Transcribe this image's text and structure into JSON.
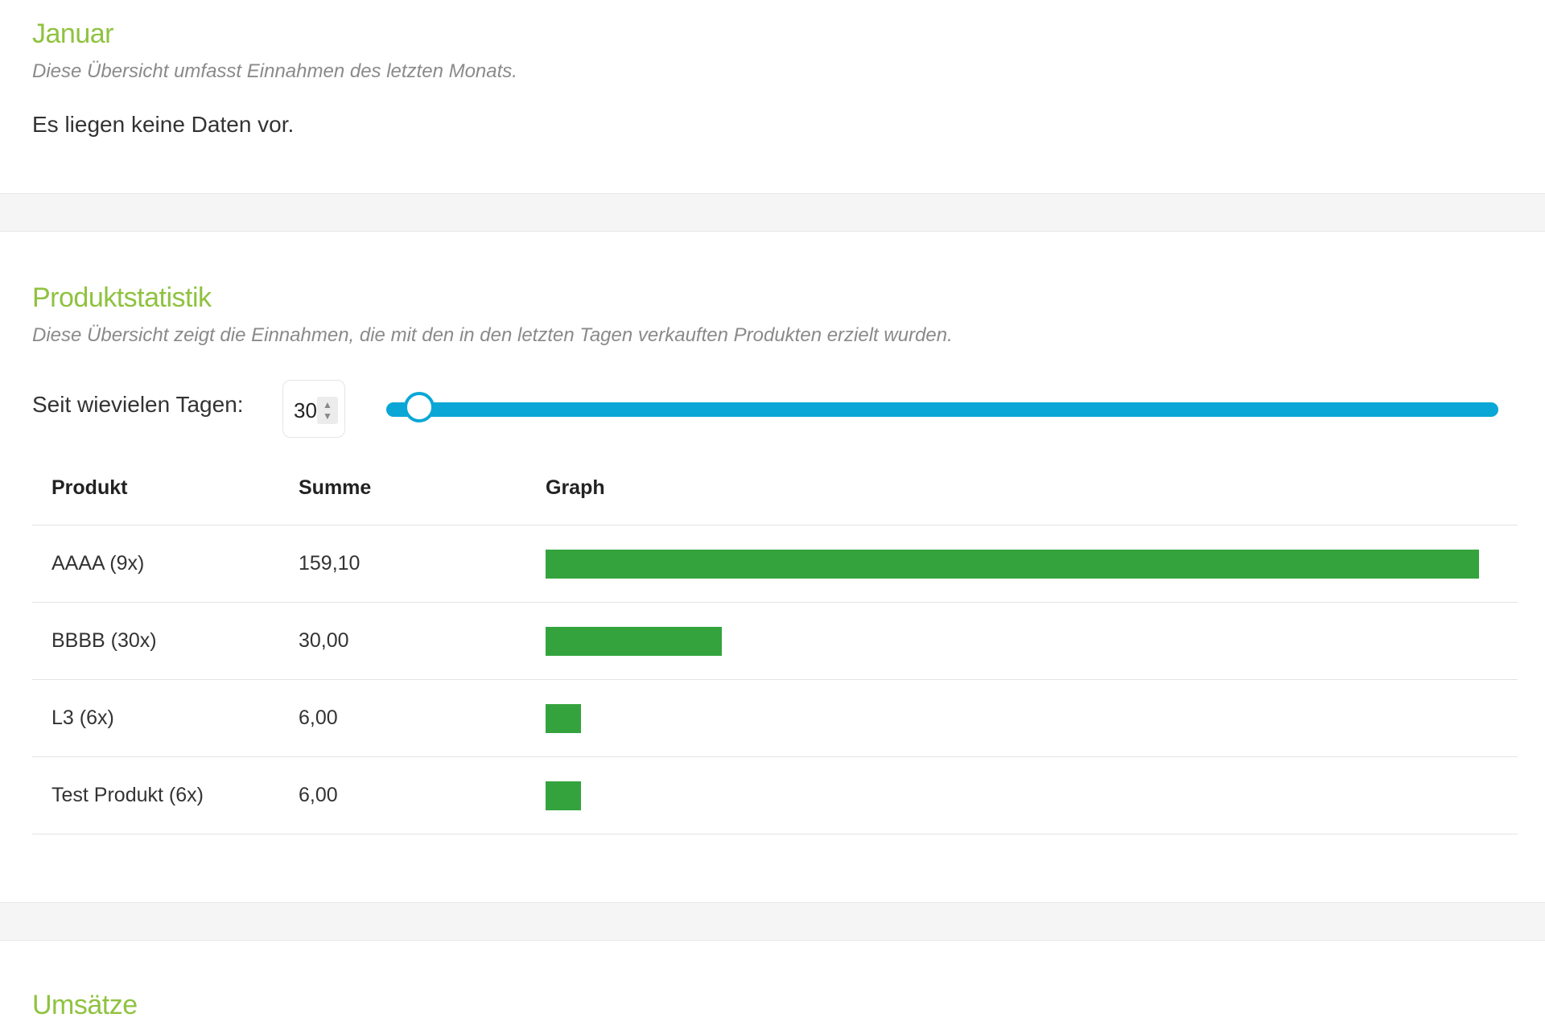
{
  "januar": {
    "title": "Januar",
    "subtitle": "Diese Übersicht umfasst Einnahmen des letzten Monats.",
    "empty_text": "Es liegen keine Daten vor."
  },
  "produktstatistik": {
    "title": "Produktstatistik",
    "subtitle": "Diese Übersicht zeigt die Einnahmen, die mit den in den letzten Tagen verkauften Produkten erzielt wurden.",
    "days_label": "Seit wievielen Tagen:",
    "days_value": "30",
    "slider_fraction": 0.03,
    "accent_color": "#0aa7d6",
    "bar_color": "#34a33e",
    "columns": [
      "Produkt",
      "Summe",
      "Graph"
    ],
    "rows": [
      {
        "product": "AAAA (9x)",
        "sum": "159,10",
        "value": 159.1
      },
      {
        "product": "BBBB (30x)",
        "sum": "30,00",
        "value": 30.0
      },
      {
        "product": "L3 (6x)",
        "sum": "6,00",
        "value": 6.0
      },
      {
        "product": "Test Produkt (6x)",
        "sum": "6,00",
        "value": 6.0
      }
    ]
  },
  "umsaetze": {
    "title": "Umsätze"
  },
  "heading_color": "#8fc23f"
}
